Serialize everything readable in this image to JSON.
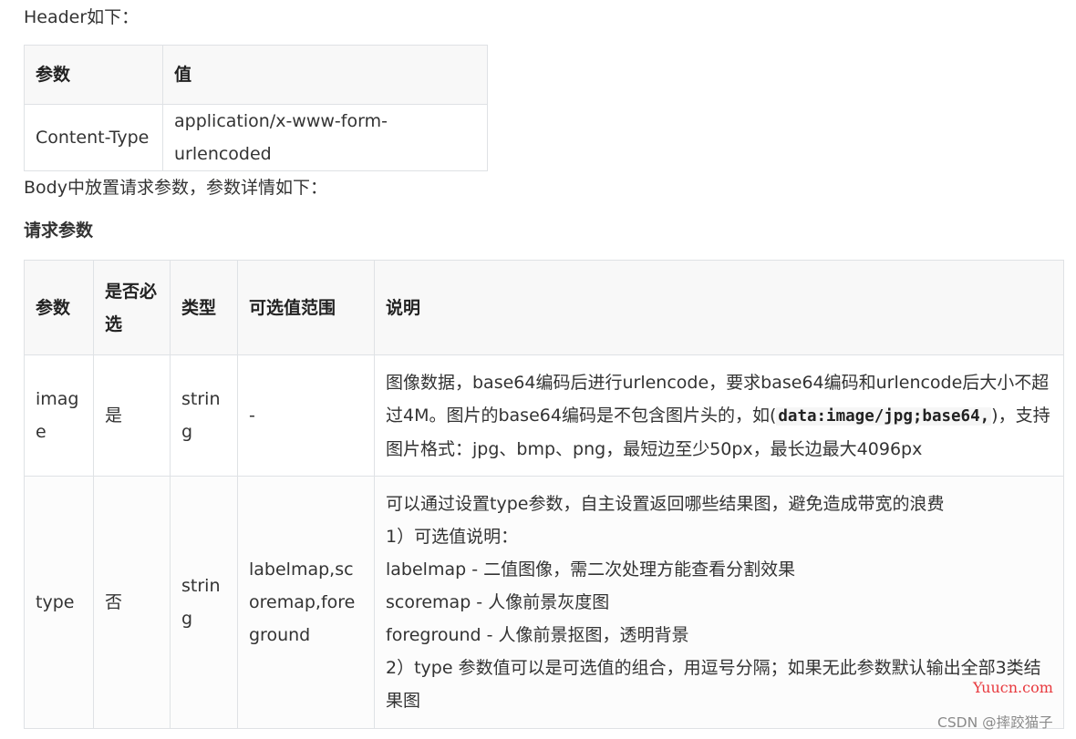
{
  "header_intro": "Header如下：",
  "header_table": {
    "columns": [
      "参数",
      "值"
    ],
    "rows": [
      [
        "Content-Type",
        "application/x-www-form-urlencoded"
      ]
    ]
  },
  "body_intro": "Body中放置请求参数，参数详情如下：",
  "params_heading": "请求参数",
  "params_table": {
    "columns": [
      "参数",
      "是否必选",
      "类型",
      "可选值范围",
      "说明"
    ],
    "rows": [
      {
        "name": "image",
        "required": "是",
        "type": "string",
        "range": "-",
        "desc_prefix": "图像数据，base64编码后进行urlencode，要求base64编码和urlencode后大小不超过4M。图片的base64编码是不包含图片头的，如(",
        "desc_code": "data:image/jpg;base64,",
        "desc_suffix": ")，支持图片格式：jpg、bmp、png，最短边至少50px，最长边最大4096px"
      },
      {
        "name": "type",
        "required": "否",
        "type": "string",
        "range": "labelmap,scoremap,foreground",
        "desc_lines": [
          "可以通过设置type参数，自主设置返回哪些结果图，避免造成带宽的浪费",
          "1）可选值说明：",
          "labelmap - 二值图像，需二次处理方能查看分割效果",
          "scoremap - 人像前景灰度图",
          "foreground - 人像前景抠图，透明背景",
          "2）type 参数值可以是可选值的组合，用逗号分隔；如果无此参数默认输出全部3类结果图"
        ]
      }
    ]
  },
  "watermark_site": "Yuucn.com",
  "watermark_csdn": "CSDN @摔跤猫子"
}
